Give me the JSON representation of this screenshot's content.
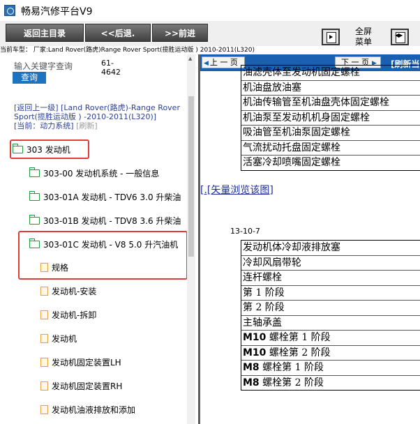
{
  "window": {
    "title": "畅易汽修平台V9"
  },
  "toolbar": {
    "home_label": "返回主目录",
    "back_label": "<<后退.",
    "forward_label": ">>前进",
    "fullscreen_label": "全屏",
    "menu_label": "菜单"
  },
  "status": {
    "current_model": "当前车型：  厂家:Land Rover(路虎)Range Rover Sport(揽胜运动版 ) 2010-2011(L320)"
  },
  "left": {
    "search_placeholder": "输入关键字查询",
    "mini_text": "61-\n4642",
    "query_button": "查询",
    "back_link": "[返回上一级]",
    "breadcrumb": "[Land Rover(路虎)-Range Rover Sport(揽胜运动版 ) -2010-2011(L320)]",
    "current": "[当前：动力系统]",
    "refresh": "[刷新]",
    "tree": [
      {
        "label": "303 发动机",
        "type": "folder"
      },
      {
        "label": "303-00 发动机系统 - 一般信息",
        "type": "folder"
      },
      {
        "label": "303-01A 发动机 - TDV6 3.0 升柴油",
        "type": "folder"
      },
      {
        "label": "303-01B 发动机 - TDV8 3.6 升柴油",
        "type": "folder"
      },
      {
        "label": "303-01C 发动机 - V8 5.0 升汽油机",
        "type": "folder"
      },
      {
        "label": "规格",
        "type": "doc"
      },
      {
        "label": "发动机-安装",
        "type": "doc"
      },
      {
        "label": "发动机-拆卸",
        "type": "doc"
      },
      {
        "label": "发动机",
        "type": "doc"
      },
      {
        "label": "发动机固定装置LH",
        "type": "doc"
      },
      {
        "label": "发动机固定装置RH",
        "type": "doc"
      },
      {
        "label": "发动机油液排放和添加",
        "type": "doc"
      }
    ]
  },
  "right": {
    "prev_page": "上 一 页",
    "next_page": "下 一 页",
    "refresh": "刷新当",
    "table1": [
      "油滤壳体至发动机固定螺栓",
      "机油盘放油塞",
      "机油传输管至机油盘壳体固定螺栓",
      "机油泵至发动机机身固定螺栓",
      "吸油管至机油泵固定螺栓",
      "气流扰动托盘固定螺栓",
      "活塞冷却喷嘴固定螺栓"
    ],
    "vector_link": "[.[矢量浏览该图]",
    "page_number": "13-10-7",
    "table2": [
      {
        "bold": "",
        "text": "发动机体冷却液排放塞"
      },
      {
        "bold": "",
        "text": "冷却风扇带轮"
      },
      {
        "bold": "",
        "text": "连杆螺栓"
      },
      {
        "bold": "",
        "text": "第 1 阶段"
      },
      {
        "bold": "",
        "text": "第 2 阶段"
      },
      {
        "bold": "",
        "text": "主轴承盖"
      },
      {
        "bold": "M10",
        "text": " 螺栓第 1 阶段"
      },
      {
        "bold": "M10",
        "text": " 螺栓第 2 阶段"
      },
      {
        "bold": "M8",
        "text": " 螺栓第 1 阶段"
      },
      {
        "bold": "M8",
        "text": " 螺栓第 2 阶段"
      }
    ]
  }
}
